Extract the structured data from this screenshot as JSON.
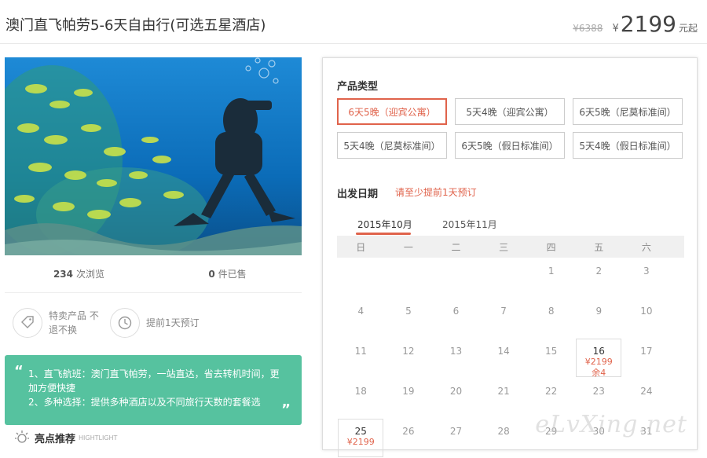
{
  "header": {
    "title": "澳门直飞帕劳5-6天自由行(可选五星酒店)",
    "old_price": "¥6388",
    "currency": "¥",
    "price": "2199",
    "price_suffix": "元起"
  },
  "stats": {
    "views_count": "234",
    "views_label": "次浏览",
    "sold_count": "0",
    "sold_label": "件已售"
  },
  "features": [
    {
      "icon": "tag-icon",
      "text": "特卖产品 不退不换"
    },
    {
      "icon": "clock-icon",
      "text": "提前1天预订"
    }
  ],
  "quote": {
    "line1": "1、直飞航班：澳门直飞帕劳，一站直达，省去转机时间，更加方便快捷",
    "line2": "2、多种选择：提供多种酒店以及不同旅行天数的套餐选"
  },
  "highlight": {
    "title": "亮点推荐",
    "sub": "HIGHTLIGHT"
  },
  "product": {
    "label": "产品类型",
    "types": [
      "6天5晚（迎宾公寓）",
      "5天4晚（迎宾公寓）",
      "6天5晚（尼莫标准间）",
      "5天4晚（尼莫标准间）",
      "6天5晚（假日标准间）",
      "5天4晚（假日标准间）"
    ],
    "selected": 0
  },
  "date": {
    "label": "出发日期",
    "notice": "请至少提前1天预订",
    "months": [
      "2015年10月",
      "2015年11月"
    ],
    "weekdays": [
      "日",
      "一",
      "二",
      "三",
      "四",
      "五",
      "六"
    ],
    "rows": [
      [
        "",
        "",
        "",
        "",
        "1",
        "2",
        "3"
      ],
      [
        "4",
        "5",
        "6",
        "7",
        "8",
        "9",
        "10"
      ],
      [
        "11",
        "12",
        "13",
        "14",
        "15",
        "16",
        "17"
      ],
      [
        "18",
        "19",
        "20",
        "21",
        "22",
        "23",
        "24"
      ],
      [
        "25",
        "26",
        "27",
        "28",
        "29",
        "30",
        "31"
      ]
    ],
    "available": {
      "16": {
        "price": "¥2199",
        "stock": "余4"
      },
      "25": {
        "price": "¥2199",
        "stock": ""
      }
    }
  },
  "watermark": "eLvXing.net",
  "colors": {
    "accent": "#e0634b",
    "quote_bg": "#56c29f"
  }
}
